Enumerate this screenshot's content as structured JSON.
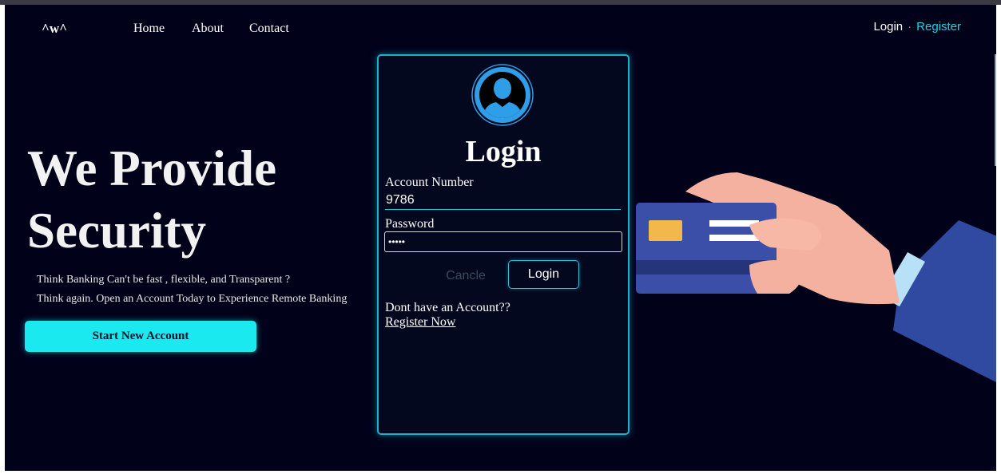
{
  "brand": "^w^",
  "nav": {
    "home": "Home",
    "about": "About",
    "contact": "Contact"
  },
  "auth": {
    "login": "Login",
    "separator": "·",
    "register": "Register"
  },
  "hero": {
    "title_line1": "We Provide",
    "title_line2": "Security",
    "tagline1": "Think Banking Can't be fast , flexible, and Transparent ?",
    "tagline2": "Think again. Open an Account Today to Experience Remote Banking",
    "cta": "Start New Account"
  },
  "login_card": {
    "title": "Login",
    "account_label": "Account Number",
    "account_value": "9786",
    "password_label": "Password",
    "password_value": "•••••",
    "cancel_label": "Cancle",
    "login_label": "Login",
    "no_account_text": "Dont have an Account??",
    "register_link": "Register Now"
  },
  "colors": {
    "background": "#01011a",
    "accent_cyan": "#1ae9ef",
    "register_link": "#16d6e6",
    "card_border": "#1ab2c9",
    "avatar_blue": "#2f9ee8"
  },
  "icons": {
    "avatar": "user-avatar-icon",
    "illustration": "hand-holding-credit-card"
  }
}
